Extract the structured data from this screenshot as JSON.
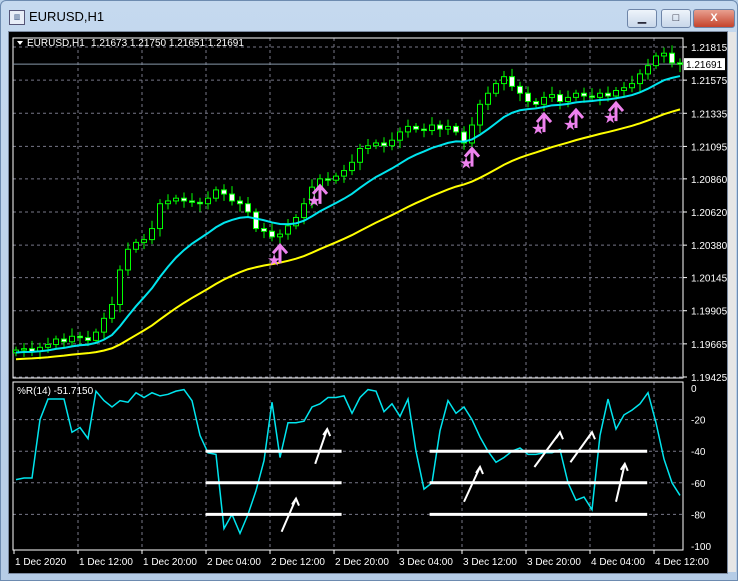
{
  "window": {
    "title": "EURUSD,H1",
    "minimize_label": "▭",
    "maximize_label": "□",
    "close_label": "X"
  },
  "chart_header": {
    "symbol": "EURUSD,H1",
    "ohlc": "1.21673 1.21750 1.21651 1.21691"
  },
  "colors": {
    "bull": "#00ff00",
    "ma_fast": "#00e5ee",
    "ma_slow": "#ffff00",
    "signal": "#ee82ee",
    "wpr": "#00e5ee",
    "annot": "#ffffff"
  },
  "price_axis": {
    "labels": [
      "1.21815",
      "1.21575",
      "1.21335",
      "1.21095",
      "1.20860",
      "1.20620",
      "1.20380",
      "1.20145",
      "1.19905",
      "1.19665",
      "1.19425"
    ],
    "current_price": "1.21691",
    "min": 1.19425,
    "max": 1.21815
  },
  "indicator": {
    "label": "%R(14) -51.7150",
    "axis_labels": [
      "0",
      "-20",
      "-40",
      "-60",
      "-80",
      "-100"
    ],
    "levels": [
      0,
      -20,
      -40,
      -60,
      -80,
      -100
    ]
  },
  "time_axis": [
    "1 Dec 2020",
    "1 Dec 12:00",
    "1 Dec 20:00",
    "2 Dec 04:00",
    "2 Dec 12:00",
    "2 Dec 20:00",
    "3 Dec 04:00",
    "3 Dec 12:00",
    "3 Dec 20:00",
    "4 Dec 04:00",
    "4 Dec 12:00"
  ],
  "chart_data": {
    "type": "candlestick",
    "closes": [
      1.1962,
      1.1963,
      1.1961,
      1.1964,
      1.1966,
      1.197,
      1.1968,
      1.1972,
      1.1971,
      1.1969,
      1.1975,
      1.1985,
      1.1995,
      1.202,
      1.2035,
      1.204,
      1.2042,
      1.205,
      1.2068,
      1.207,
      1.2072,
      1.207,
      1.2069,
      1.2068,
      1.2072,
      1.2078,
      1.2075,
      1.207,
      1.2068,
      1.2062,
      1.205,
      1.2048,
      1.2044,
      1.2046,
      1.2052,
      1.2058,
      1.2068,
      1.208,
      1.2086,
      1.2085,
      1.2088,
      1.2092,
      1.2098,
      1.2108,
      1.211,
      1.2112,
      1.211,
      1.2114,
      1.212,
      1.2124,
      1.2122,
      1.2121,
      1.2125,
      1.2122,
      1.2124,
      1.212,
      1.2112,
      1.2125,
      1.214,
      1.2148,
      1.2155,
      1.216,
      1.2153,
      1.2148,
      1.2142,
      1.214,
      1.2145,
      1.2147,
      1.2142,
      1.2145,
      1.2148,
      1.2146,
      1.2145,
      1.2148,
      1.2146,
      1.215,
      1.2152,
      1.2155,
      1.2162,
      1.2168,
      1.2175,
      1.2177,
      1.217,
      1.2169
    ],
    "wpr": [
      -58,
      -57,
      -57,
      -20,
      -7,
      -7,
      -7,
      -28,
      -25,
      -32,
      -2,
      -8,
      -12,
      -8,
      -9,
      -3,
      -6,
      -3,
      -5,
      -4,
      -2,
      -1,
      -8,
      -30,
      -41,
      -42,
      -89,
      -80,
      -92,
      -80,
      -65,
      -46,
      -9,
      -44,
      -22,
      -22,
      -21,
      -12,
      -10,
      -6,
      -6,
      -5,
      -16,
      -6,
      -1,
      -2,
      -15,
      -10,
      -18,
      -7,
      -40,
      -64,
      -60,
      -27,
      -8,
      -16,
      -12,
      -20,
      -31,
      -40,
      -47,
      -44,
      -40,
      -38,
      -42,
      -42,
      -41,
      -41,
      -39,
      -60,
      -71,
      -69,
      -77,
      -30,
      -7,
      -26,
      -17,
      -14,
      -10,
      -3,
      -22,
      -45,
      -60,
      -68
    ],
    "signals": [
      {
        "bar": 33,
        "price": 1.2035
      },
      {
        "bar": 38,
        "price": 1.2078
      },
      {
        "bar": 57,
        "price": 1.2105
      },
      {
        "bar": 66,
        "price": 1.213
      },
      {
        "bar": 70,
        "price": 1.2133
      },
      {
        "bar": 75,
        "price": 1.2138
      }
    ],
    "level_segments": [
      {
        "from": 23.7,
        "to": 40.7,
        "levels": [
          -40,
          -60,
          -80
        ]
      },
      {
        "from": 51.7,
        "to": 78.9,
        "levels": [
          -40,
          -60,
          -80
        ]
      }
    ],
    "annot_arrows": [
      [
        33.2,
        -91,
        35,
        -70
      ],
      [
        37.4,
        -48,
        38.9,
        -26
      ],
      [
        56,
        -72,
        58,
        -50
      ],
      [
        64.8,
        -50,
        68,
        -28
      ],
      [
        69.3,
        -47,
        72,
        -28
      ],
      [
        75,
        -72,
        76.1,
        -48
      ]
    ]
  }
}
